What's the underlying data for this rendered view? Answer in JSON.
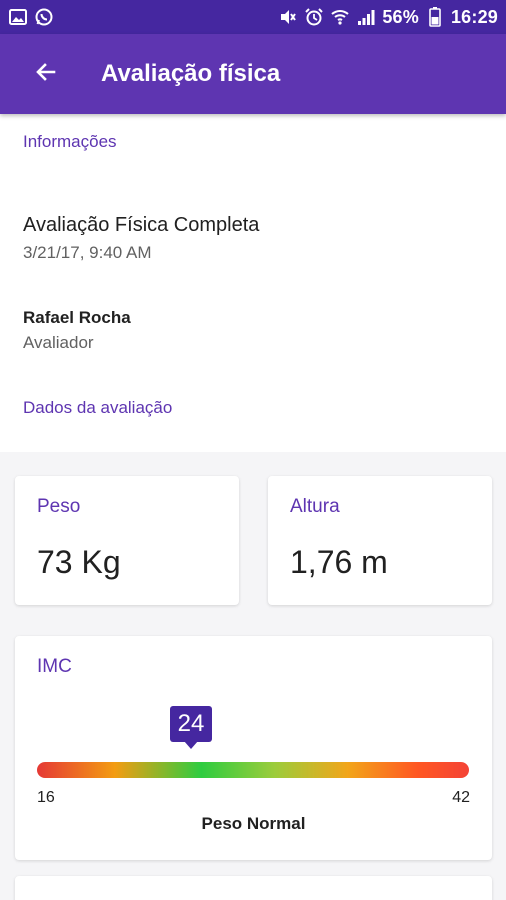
{
  "status_bar": {
    "battery": "56%",
    "time": "16:29",
    "icons_left": [
      "image-icon",
      "whatsapp-icon"
    ],
    "icons_right": [
      "mute-icon",
      "alarm-icon",
      "wifi-icon",
      "signal-icon"
    ]
  },
  "app_bar": {
    "title": "Avaliação física",
    "back_icon": "arrow-back-icon"
  },
  "sections": {
    "info": "Informações",
    "data": "Dados da avaliação"
  },
  "evaluation": {
    "title": "Avaliação Física Completa",
    "date": "3/21/17, 9:40 AM"
  },
  "evaluator": {
    "name": "Rafael Rocha",
    "role": "Avaliador"
  },
  "metrics": {
    "peso": {
      "label": "Peso",
      "value": "73 Kg"
    },
    "altura": {
      "label": "Altura",
      "value": "1,76 m"
    }
  },
  "imc": {
    "label": "IMC",
    "value": "24",
    "min": "16",
    "max": "42",
    "status": "Peso Normal"
  },
  "colors": {
    "accent": "#5e35b1",
    "status_bar": "#4527a0"
  }
}
